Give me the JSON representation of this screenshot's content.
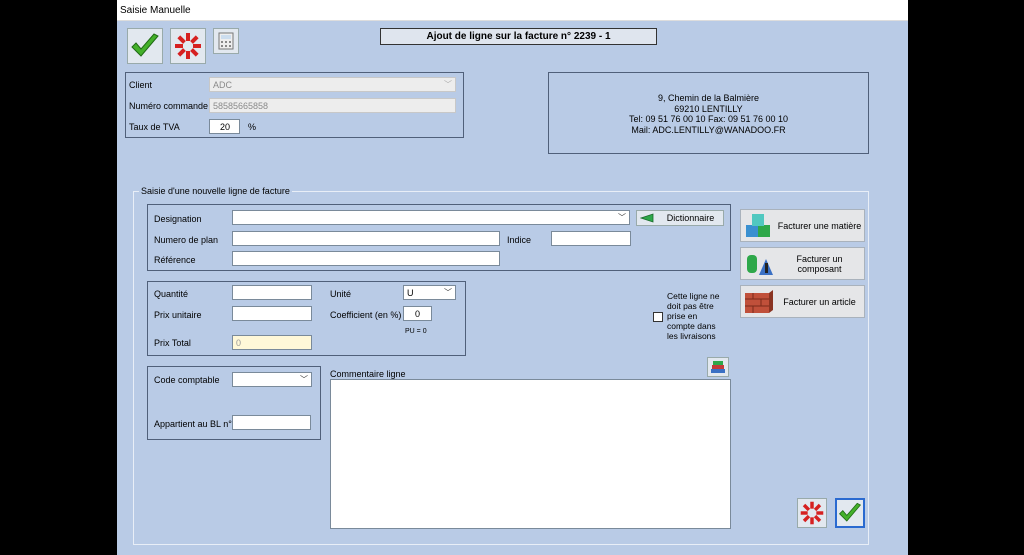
{
  "window": {
    "title": "Saisie Manuelle"
  },
  "toolbar": {
    "validate_icon": "check-icon",
    "cancel_icon": "cancel-icon",
    "calc_icon": "calculator-icon"
  },
  "header": {
    "title": "Ajout de ligne sur la facture n° 2239 - 1"
  },
  "client_box": {
    "client_label": "Client",
    "client_value": "ADC",
    "order_label": "Numéro commande",
    "order_value": "58585665858",
    "tva_label": "Taux de TVA",
    "tva_value": "20",
    "tva_unit": "%"
  },
  "address": {
    "line1": "9, Chemin de la Balmière",
    "line2": "69210 LENTILLY",
    "line3": "Tel: 09 51 76 00 10   Fax: 09 51 76 00 10",
    "line4": "Mail: ADC.LENTILLY@WANADOO.FR"
  },
  "form": {
    "legend": "Saisie d'une nouvelle ligne de facture",
    "designation_label": "Designation",
    "designation_value": "",
    "dictionary_button": "Dictionnaire",
    "plan_label": "Numero de plan",
    "plan_value": "",
    "indice_label": "Indice",
    "indice_value": "",
    "reference_label": "Référence",
    "reference_value": "",
    "quantity_label": "Quantité",
    "quantity_value": "",
    "unit_label": "Unité",
    "unit_value": "U",
    "unit_price_label": "Prix unitaire",
    "unit_price_value": "",
    "coef_label": "Coefficient (en %)",
    "coef_value": "0",
    "pu_note": "PU = 0",
    "total_label": "Prix Total",
    "total_value": "0",
    "account_label": "Code comptable",
    "account_value": "",
    "bl_label": "Appartient au BL n°",
    "bl_value": "",
    "comment_label": "Commentaire ligne",
    "comment_value": "",
    "exclude_lines": [
      "Cette ligne ne",
      "doit pas être",
      "prise en",
      "compte dans",
      "les livraisons"
    ],
    "exclude_checked": false
  },
  "side_buttons": {
    "matiere": "Facturer une matière",
    "composant": "Facturer un composant",
    "article": "Facturer un article"
  },
  "colors": {
    "window_bg": "#b9cbe6",
    "accent_green": "#2a9a2a",
    "cancel_red": "#d62020"
  }
}
